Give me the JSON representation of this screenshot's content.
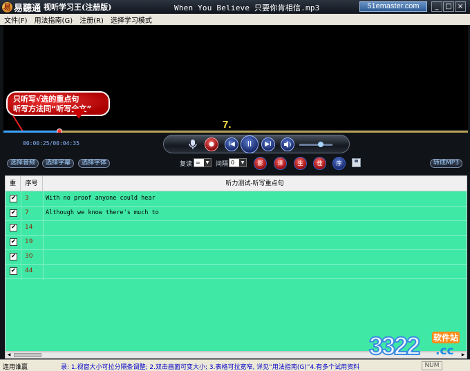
{
  "window": {
    "brand": "易聽通",
    "subtitle": "视听学习王(注册版)",
    "song_title": "When You Believe 只要你肯相信.mp3",
    "site_badge": "51emaster.com",
    "buttons": {
      "minimize": "_",
      "maximize": "□",
      "close": "×"
    }
  },
  "menu": [
    "文件(F)",
    "用法指南(G)",
    "注册(R)",
    "选择学习模式"
  ],
  "player": {
    "timecode": "00:00:25/00:04:35",
    "sentence_number": "7.",
    "progress_fraction": 0.12,
    "volume_fraction": 0.65,
    "buttons": {
      "prev": "I◀",
      "play": "II",
      "next": "▶I",
      "rec": "●"
    }
  },
  "options": {
    "select_audio": "选择音频",
    "select_subtitle": "选择字幕",
    "select_font": "选择字体",
    "repeat_label": "复读",
    "repeat_value": "∞",
    "interval_label": "间隔",
    "interval_value": "0",
    "mode_buttons": [
      "影",
      "译",
      "生",
      "佳",
      "序"
    ],
    "convert_mp3": "转成MP3"
  },
  "callout": {
    "line1": "只听写√选的重点句",
    "line2": "听写方法同“听写全文”"
  },
  "table": {
    "headers": {
      "check": "重",
      "index": "序号",
      "content": "听力测试-听写重点句"
    },
    "rows": [
      {
        "checked": true,
        "index": "3",
        "text": " With no proof anyone could hear"
      },
      {
        "checked": true,
        "index": "7",
        "text": "Although we know there's much to"
      },
      {
        "checked": true,
        "index": "14",
        "text": ""
      },
      {
        "checked": true,
        "index": "19",
        "text": ""
      },
      {
        "checked": true,
        "index": "30",
        "text": ""
      },
      {
        "checked": true,
        "index": "44",
        "text": ""
      }
    ],
    "check_mark": "✔"
  },
  "status": {
    "left": "连用谁赢",
    "hint": "录: 1.视窗大小可拉分隔条调整; 2.双击画面可变大小; 3.表格可拉宽窄, 详见“用法指南(G)”4.有多个试用资料",
    "num": "NUM"
  },
  "watermark": {
    "digits": "3322",
    "tag": "软件站",
    "suffix": ".cc"
  }
}
